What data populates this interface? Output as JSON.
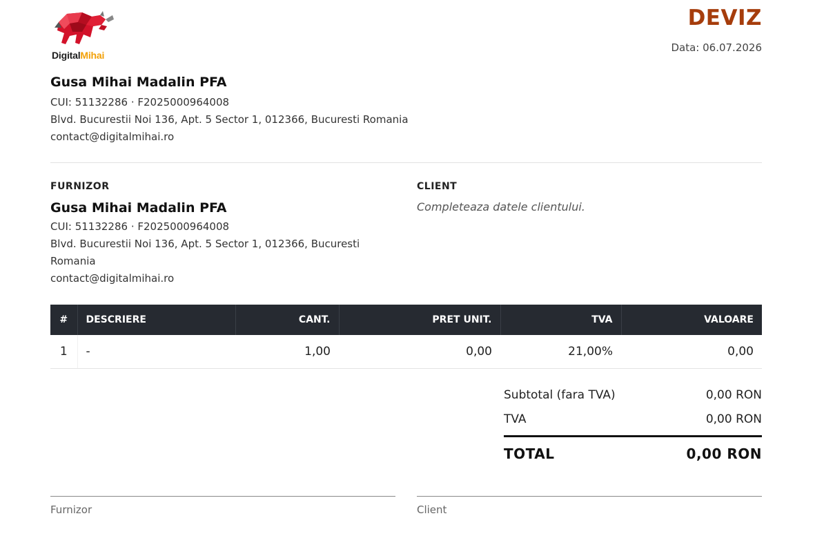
{
  "header": {
    "logo": {
      "text_part1": "Digital",
      "text_part2": "Mihai",
      "icon": "bull-logo-icon"
    },
    "doc_title": "DEVIZ",
    "date_label": "Data: 06.07.2026"
  },
  "company": {
    "name": "Gusa Mihai Madalin PFA",
    "ids": "CUI: 51132286 · F2025000964008",
    "address": "Blvd. Bucurestii Noi 136, Apt. 5 Sector 1, 012366, Bucuresti Romania",
    "email": "contact@digitalmihai.ro"
  },
  "furnizor": {
    "label": "FURNIZOR",
    "name": "Gusa Mihai Madalin PFA",
    "ids": "CUI: 51132286 · F2025000964008",
    "address": "Blvd. Bucurestii Noi 136, Apt. 5 Sector 1, 012366, Bucuresti Romania",
    "email": "contact@digitalmihai.ro"
  },
  "client": {
    "label": "CLIENT",
    "placeholder": "Completeaza datele clientului."
  },
  "table": {
    "columns": [
      "#",
      "DESCRIERE",
      "CANT.",
      "PRET UNIT.",
      "TVA",
      "VALOARE"
    ],
    "rows": [
      [
        "1",
        "-",
        "1,00",
        "0,00",
        "21,00%",
        "0,00"
      ]
    ]
  },
  "totals": {
    "subtotal_label": "Subtotal (fara TVA)",
    "subtotal_value": "0,00 RON",
    "tva_label": "TVA",
    "tva_value": "0,00 RON",
    "total_label": "TOTAL",
    "total_value": "0,00 RON"
  },
  "signatures": {
    "furnizor": "Furnizor",
    "client": "Client"
  },
  "colors": {
    "title": "#a63d0c",
    "table_header_bg": "#262a31",
    "logo_red": "#d3122a",
    "logo_orange": "#f2a007"
  }
}
